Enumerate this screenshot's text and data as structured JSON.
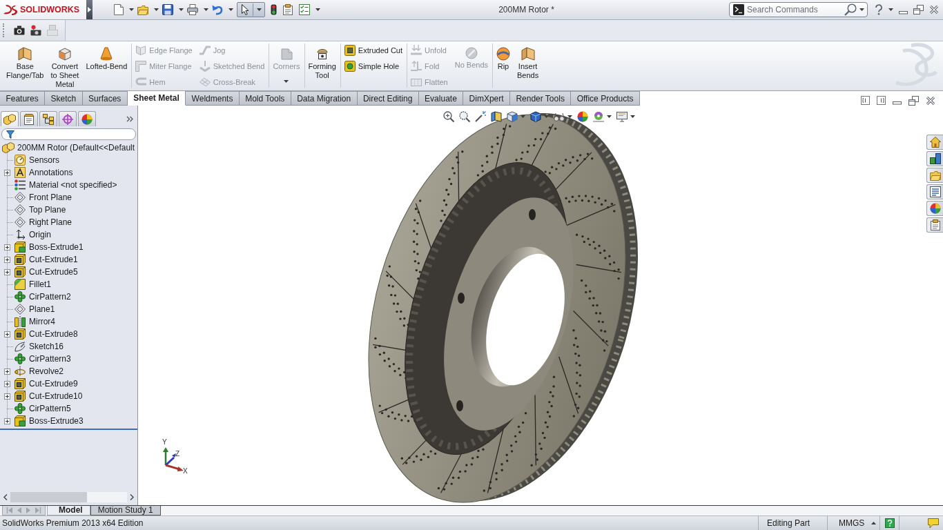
{
  "title_bar": {
    "logo_text": "SOLIDWORKS",
    "select_tool": {
      "pressed": true
    },
    "document_title": "200MM Rotor *",
    "search": {
      "placeholder": "Search Commands"
    }
  },
  "ribbon": {
    "groups": [
      {
        "tools": [
          {
            "kind": "large",
            "label": "Base\nFlange/Tab",
            "disabled": false
          },
          {
            "kind": "large",
            "label": "Convert\nto Sheet\nMetal",
            "disabled": false
          },
          {
            "kind": "large",
            "label": "Lofted-Bend",
            "disabled": false
          }
        ]
      },
      {
        "tools": [
          {
            "kind": "stack",
            "items": [
              {
                "label": "Edge Flange",
                "disabled": true
              },
              {
                "label": "Miter Flange",
                "disabled": true
              },
              {
                "label": "Hem",
                "disabled": true
              }
            ]
          },
          {
            "kind": "stack",
            "items": [
              {
                "label": "Jog",
                "disabled": true
              },
              {
                "label": "Sketched Bend",
                "disabled": true
              },
              {
                "label": "Cross-Break",
                "disabled": true
              }
            ]
          }
        ]
      },
      {
        "tools": [
          {
            "kind": "large",
            "label": "Corners",
            "disabled": true,
            "dropdown": true
          }
        ]
      },
      {
        "tools": [
          {
            "kind": "large",
            "label": "Forming\nTool",
            "disabled": false
          }
        ]
      },
      {
        "tools": [
          {
            "kind": "stack",
            "items": [
              {
                "label": "Extruded Cut",
                "disabled": false
              },
              {
                "label": "Simple Hole",
                "disabled": false
              }
            ]
          }
        ]
      },
      {
        "tools": [
          {
            "kind": "stack",
            "items": [
              {
                "label": "Unfold",
                "disabled": true
              },
              {
                "label": "Fold",
                "disabled": true
              },
              {
                "label": "Flatten",
                "disabled": true
              }
            ]
          },
          {
            "kind": "large",
            "label": "No Bends",
            "disabled": true
          }
        ]
      },
      {
        "tools": [
          {
            "kind": "large",
            "label": "Rip",
            "disabled": false
          },
          {
            "kind": "large",
            "label": "Insert\nBends",
            "disabled": false
          }
        ]
      }
    ]
  },
  "command_tabs": [
    {
      "label": "Features",
      "selected": false
    },
    {
      "label": "Sketch",
      "selected": false
    },
    {
      "label": "Surfaces",
      "selected": false
    },
    {
      "label": "Sheet Metal",
      "selected": true
    },
    {
      "label": "Weldments",
      "selected": false
    },
    {
      "label": "Mold Tools",
      "selected": false
    },
    {
      "label": "Data Migration",
      "selected": false
    },
    {
      "label": "Direct Editing",
      "selected": false
    },
    {
      "label": "Evaluate",
      "selected": false
    },
    {
      "label": "DimXpert",
      "selected": false
    },
    {
      "label": "Render Tools",
      "selected": false
    },
    {
      "label": "Office Products",
      "selected": false
    }
  ],
  "feature_tree": {
    "panel_tabs": [
      {
        "kind": "features",
        "selected": true
      },
      {
        "kind": "properties",
        "selected": false
      },
      {
        "kind": "configurations",
        "selected": false
      },
      {
        "kind": "dimxpert",
        "selected": false
      },
      {
        "kind": "display",
        "selected": false
      }
    ],
    "root": {
      "label": "200MM Rotor (Default<<Default",
      "children": [
        {
          "label": "Sensors",
          "kind": "sensors"
        },
        {
          "label": "Annotations",
          "kind": "annotations",
          "expanded": false
        },
        {
          "label": "Material <not specified>",
          "kind": "material"
        },
        {
          "label": "Front Plane",
          "kind": "plane"
        },
        {
          "label": "Top Plane",
          "kind": "plane"
        },
        {
          "label": "Right Plane",
          "kind": "plane"
        },
        {
          "label": "Origin",
          "kind": "origin"
        },
        {
          "label": "Boss-Extrude1",
          "kind": "boss",
          "expanded": false
        },
        {
          "label": "Cut-Extrude1",
          "kind": "cut",
          "expanded": false
        },
        {
          "label": "Cut-Extrude5",
          "kind": "cut",
          "expanded": false
        },
        {
          "label": "Fillet1",
          "kind": "fillet"
        },
        {
          "label": "CirPattern2",
          "kind": "pattern"
        },
        {
          "label": "Plane1",
          "kind": "plane"
        },
        {
          "label": "Mirror4",
          "kind": "mirror"
        },
        {
          "label": "Cut-Extrude8",
          "kind": "cut",
          "expanded": false
        },
        {
          "label": "Sketch16",
          "kind": "sketch"
        },
        {
          "label": "CirPattern3",
          "kind": "pattern"
        },
        {
          "label": "Revolve2",
          "kind": "revolve",
          "expanded": false
        },
        {
          "label": "Cut-Extrude9",
          "kind": "cut",
          "expanded": false
        },
        {
          "label": "Cut-Extrude10",
          "kind": "cut",
          "expanded": false
        },
        {
          "label": "CirPattern5",
          "kind": "pattern"
        },
        {
          "label": "Boss-Extrude3",
          "kind": "boss",
          "expanded": false
        }
      ]
    }
  },
  "graphics": {
    "triad": {
      "y_label": "Y",
      "z_label": "Z",
      "x_label": "X"
    }
  },
  "bottom_tabs": [
    {
      "label": "Model",
      "selected": true
    },
    {
      "label": "Motion Study 1",
      "selected": false
    }
  ],
  "status_bar": {
    "product": "SolidWorks Premium 2013 x64 Edition",
    "mode": "Editing Part",
    "units": "MMGS"
  }
}
